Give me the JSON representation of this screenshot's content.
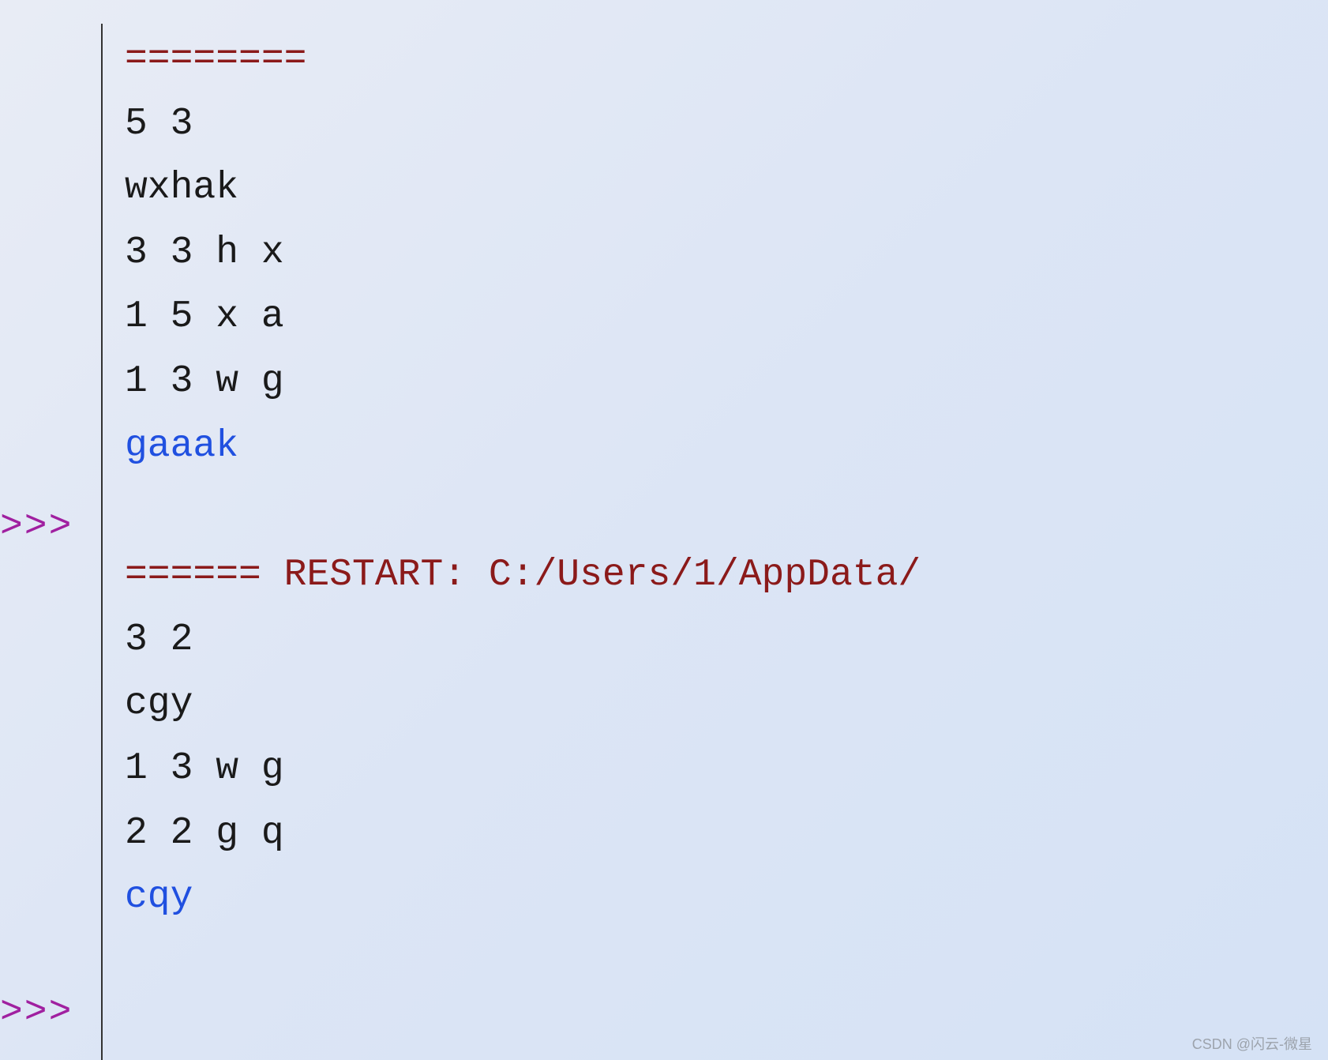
{
  "session1": {
    "divider": "========",
    "input": [
      "5 3",
      "wxhak",
      "3 3 h x",
      "1 5 x a",
      "1 3 w g"
    ],
    "output": "gaaak"
  },
  "restart": {
    "prefix": "====== ",
    "label": "RESTART: ",
    "path": "C:/Users/1/AppData/"
  },
  "session2": {
    "input": [
      "3 2",
      "cgy",
      "1 3 w g",
      "2 2 g q"
    ],
    "output": "cqy"
  },
  "prompt": ">>>",
  "watermark": "CSDN @闪云-微星"
}
